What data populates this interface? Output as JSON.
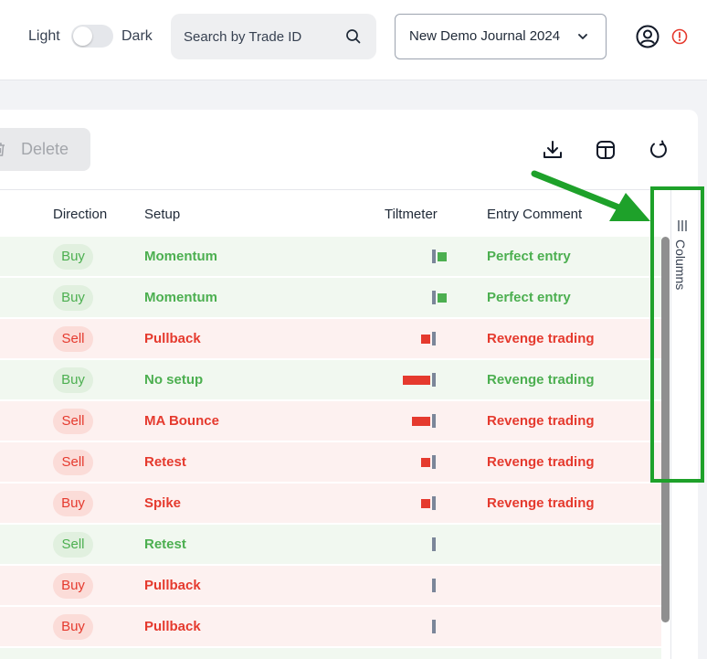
{
  "header": {
    "theme_light_label": "Light",
    "theme_dark_label": "Dark",
    "search_placeholder": "Search by Trade ID",
    "journal_selected": "New Demo Journal 2024"
  },
  "toolbar": {
    "delete_label": "Delete"
  },
  "table": {
    "columns": [
      "Direction",
      "Setup",
      "Tiltmeter",
      "Entry Comment"
    ],
    "rows": [
      {
        "result": "win",
        "direction": "Buy",
        "setup": "Momentum",
        "tilt": 1.0,
        "comment": "Perfect entry"
      },
      {
        "result": "win",
        "direction": "Buy",
        "setup": "Momentum",
        "tilt": 1.0,
        "comment": "Perfect entry"
      },
      {
        "result": "loss",
        "direction": "Sell",
        "setup": "Pullback",
        "tilt": -1.0,
        "comment": "Revenge trading"
      },
      {
        "result": "win",
        "direction": "Buy",
        "setup": "No setup",
        "tilt": -3.0,
        "comment": "Revenge trading"
      },
      {
        "result": "loss",
        "direction": "Sell",
        "setup": "MA Bounce",
        "tilt": -2.0,
        "comment": "Revenge trading"
      },
      {
        "result": "loss",
        "direction": "Sell",
        "setup": "Retest",
        "tilt": -1.0,
        "comment": "Revenge trading"
      },
      {
        "result": "loss",
        "direction": "Buy",
        "setup": "Spike",
        "tilt": -1.0,
        "comment": "Revenge trading"
      },
      {
        "result": "win",
        "direction": "Sell",
        "setup": "Retest",
        "tilt": 0,
        "comment": ""
      },
      {
        "result": "loss",
        "direction": "Buy",
        "setup": "Pullback",
        "tilt": 0,
        "comment": ""
      },
      {
        "result": "loss",
        "direction": "Buy",
        "setup": "Pullback",
        "tilt": 0,
        "comment": ""
      },
      {
        "result": "win",
        "direction": "",
        "setup": "",
        "tilt": 0,
        "comment": ""
      }
    ]
  },
  "side_panel": {
    "columns_label": "Columns"
  },
  "colors": {
    "win": "#4caf50",
    "loss": "#e53a2e",
    "annotation": "#1ea12a"
  }
}
